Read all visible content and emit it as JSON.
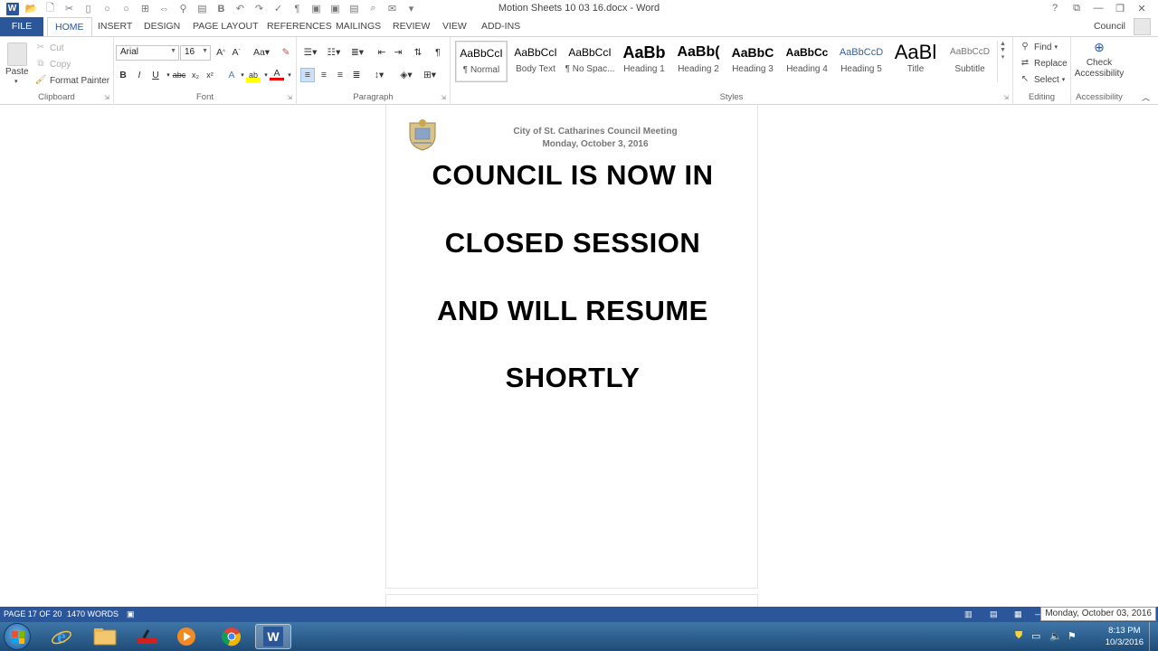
{
  "window": {
    "title": "Motion Sheets 10 03 16.docx - Word",
    "account": "Council"
  },
  "tabs": [
    "FILE",
    "HOME",
    "INSERT",
    "DESIGN",
    "PAGE LAYOUT",
    "REFERENCES",
    "MAILINGS",
    "REVIEW",
    "VIEW",
    "ADD-INS"
  ],
  "ribbon": {
    "clipboard": {
      "label": "Clipboard",
      "paste": "Paste",
      "cut": "Cut",
      "copy": "Copy",
      "format_painter": "Format Painter"
    },
    "font": {
      "label": "Font",
      "family": "Arial",
      "size": "16"
    },
    "paragraph": {
      "label": "Paragraph"
    },
    "styles": {
      "label": "Styles",
      "items": [
        {
          "preview": "AaBbCcI",
          "name": "¶ Normal"
        },
        {
          "preview": "AaBbCcI",
          "name": "Body Text"
        },
        {
          "preview": "AaBbCcI",
          "name": "¶ No Spac..."
        },
        {
          "preview": "AaBb",
          "name": "Heading 1"
        },
        {
          "preview": "AaBb(",
          "name": "Heading 2"
        },
        {
          "preview": "AaBbC",
          "name": "Heading 3"
        },
        {
          "preview": "AaBbCc",
          "name": "Heading 4"
        },
        {
          "preview": "AaBbCcD",
          "name": "Heading 5"
        },
        {
          "preview": "AaBl",
          "name": "Title"
        },
        {
          "preview": "AaBbCcD",
          "name": "Subtitle"
        }
      ]
    },
    "editing": {
      "label": "Editing",
      "find": "Find",
      "replace": "Replace",
      "select": "Select"
    },
    "accessibility": {
      "label": "Accessibility",
      "check_line1": "Check",
      "check_line2": "Accessibility"
    }
  },
  "document": {
    "header_line1": "City of St. Catharines Council Meeting",
    "header_line2": "Monday, October 3, 2016",
    "body_lines": [
      "COUNCIL IS NOW IN",
      "CLOSED SESSION",
      "AND WILL RESUME",
      "SHORTLY"
    ]
  },
  "status": {
    "page": "PAGE 17 OF 20",
    "words": "1470 WORDS",
    "date_tooltip": "Monday, October 03, 2016"
  },
  "taskbar": {
    "time": "8:13 PM",
    "date": "10/3/2016"
  },
  "colors": {
    "word_blue": "#2b579a",
    "taskbar": "#2a5f91"
  }
}
